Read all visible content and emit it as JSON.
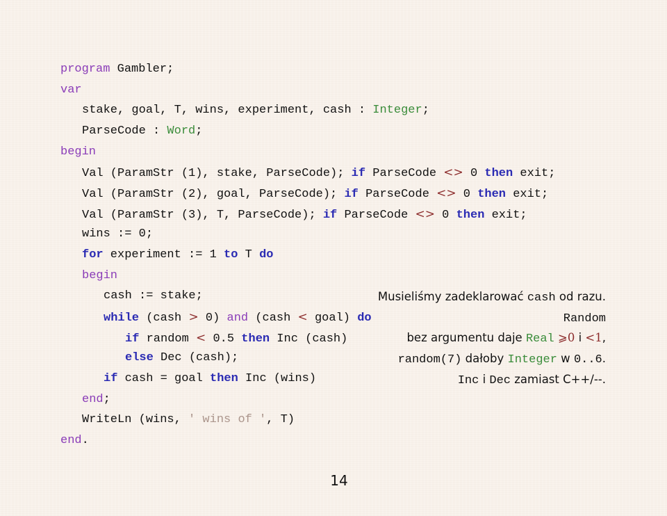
{
  "colors": {
    "background": "#f8f1ea",
    "keyword_blue": "#2b2bb3",
    "keyword_purple": "#8a3cb8",
    "type_green": "#3a8c3a",
    "operator_maroon": "#8b2a2a",
    "string_grey": "#ab958c"
  },
  "code": {
    "l1": {
      "kw": "program",
      "rest": " Gambler;"
    },
    "l2": {
      "kw": "var"
    },
    "l3": {
      "text": "stake, goal, T, wins, experiment, cash : ",
      "type": "Integer",
      "end": ";"
    },
    "l4": {
      "text": "ParseCode : ",
      "type": "Word",
      "end": ";"
    },
    "l5": {
      "kw": "begin"
    },
    "l6": {
      "text": "Val (ParamStr (1), stake, ParseCode); ",
      "if": "if",
      "mid": " ParseCode ",
      "op": "<>",
      "zero": " 0 ",
      "then": "then",
      "end": " exit;"
    },
    "l7": {
      "text": "Val (ParamStr (2), goal, ParseCode); ",
      "if": "if",
      "mid": " ParseCode ",
      "op": "<>",
      "zero": " 0 ",
      "then": "then",
      "end": " exit;"
    },
    "l8": {
      "text": "Val (ParamStr (3), T, ParseCode); ",
      "if": "if",
      "mid": " ParseCode ",
      "op": "<>",
      "zero": " 0 ",
      "then": "then",
      "end": " exit;"
    },
    "l9": {
      "text": "wins := 0;"
    },
    "l10": {
      "for": "for",
      "mid": " experiment := 1 ",
      "to": "to",
      "t": " T ",
      "do": "do"
    },
    "l11": {
      "kw": "begin"
    },
    "l12": {
      "text": "cash := stake;"
    },
    "l13": {
      "while": "while",
      "a": " (cash ",
      "gt": ">",
      "b": " 0) ",
      "and": "and",
      "c": " (cash ",
      "lt": "<",
      "d": " goal) ",
      "do": "do"
    },
    "l14": {
      "if": "if",
      "a": " random ",
      "lt": "<",
      "b": " 0.5 ",
      "then": "then",
      "c": " Inc (cash)"
    },
    "l15": {
      "else": "else",
      "a": " Dec (cash);"
    },
    "l16": {
      "if": "if",
      "a": " cash = goal ",
      "then": "then",
      "b": " Inc (wins)"
    },
    "l17": {
      "kw": "end",
      "end": ";"
    },
    "l18": {
      "a": "WriteLn (wins, ",
      "str": "' wins of '",
      "b": ", T)"
    },
    "l19": {
      "kw": "end",
      "end": "."
    }
  },
  "notes": {
    "n1": {
      "a": "Musieliśmy zadeklarować ",
      "mono": "cash",
      "b": " od razu."
    },
    "n2": {
      "mono": "Random"
    },
    "n3": {
      "a": "bez argumentu daje ",
      "type": "Real",
      "ge": " ⩾0",
      "i": " i ",
      "lt": "<1",
      "end": ","
    },
    "n4": {
      "mono": "random(7)",
      "a": " dałoby ",
      "type": "Integer",
      "b": " w ",
      "mono2": "0..6",
      "end": "."
    },
    "n5": {
      "mono": "Inc",
      "a": " i ",
      "mono2": "Dec",
      "b": " zamiast C++/--."
    }
  },
  "page_number": "14"
}
